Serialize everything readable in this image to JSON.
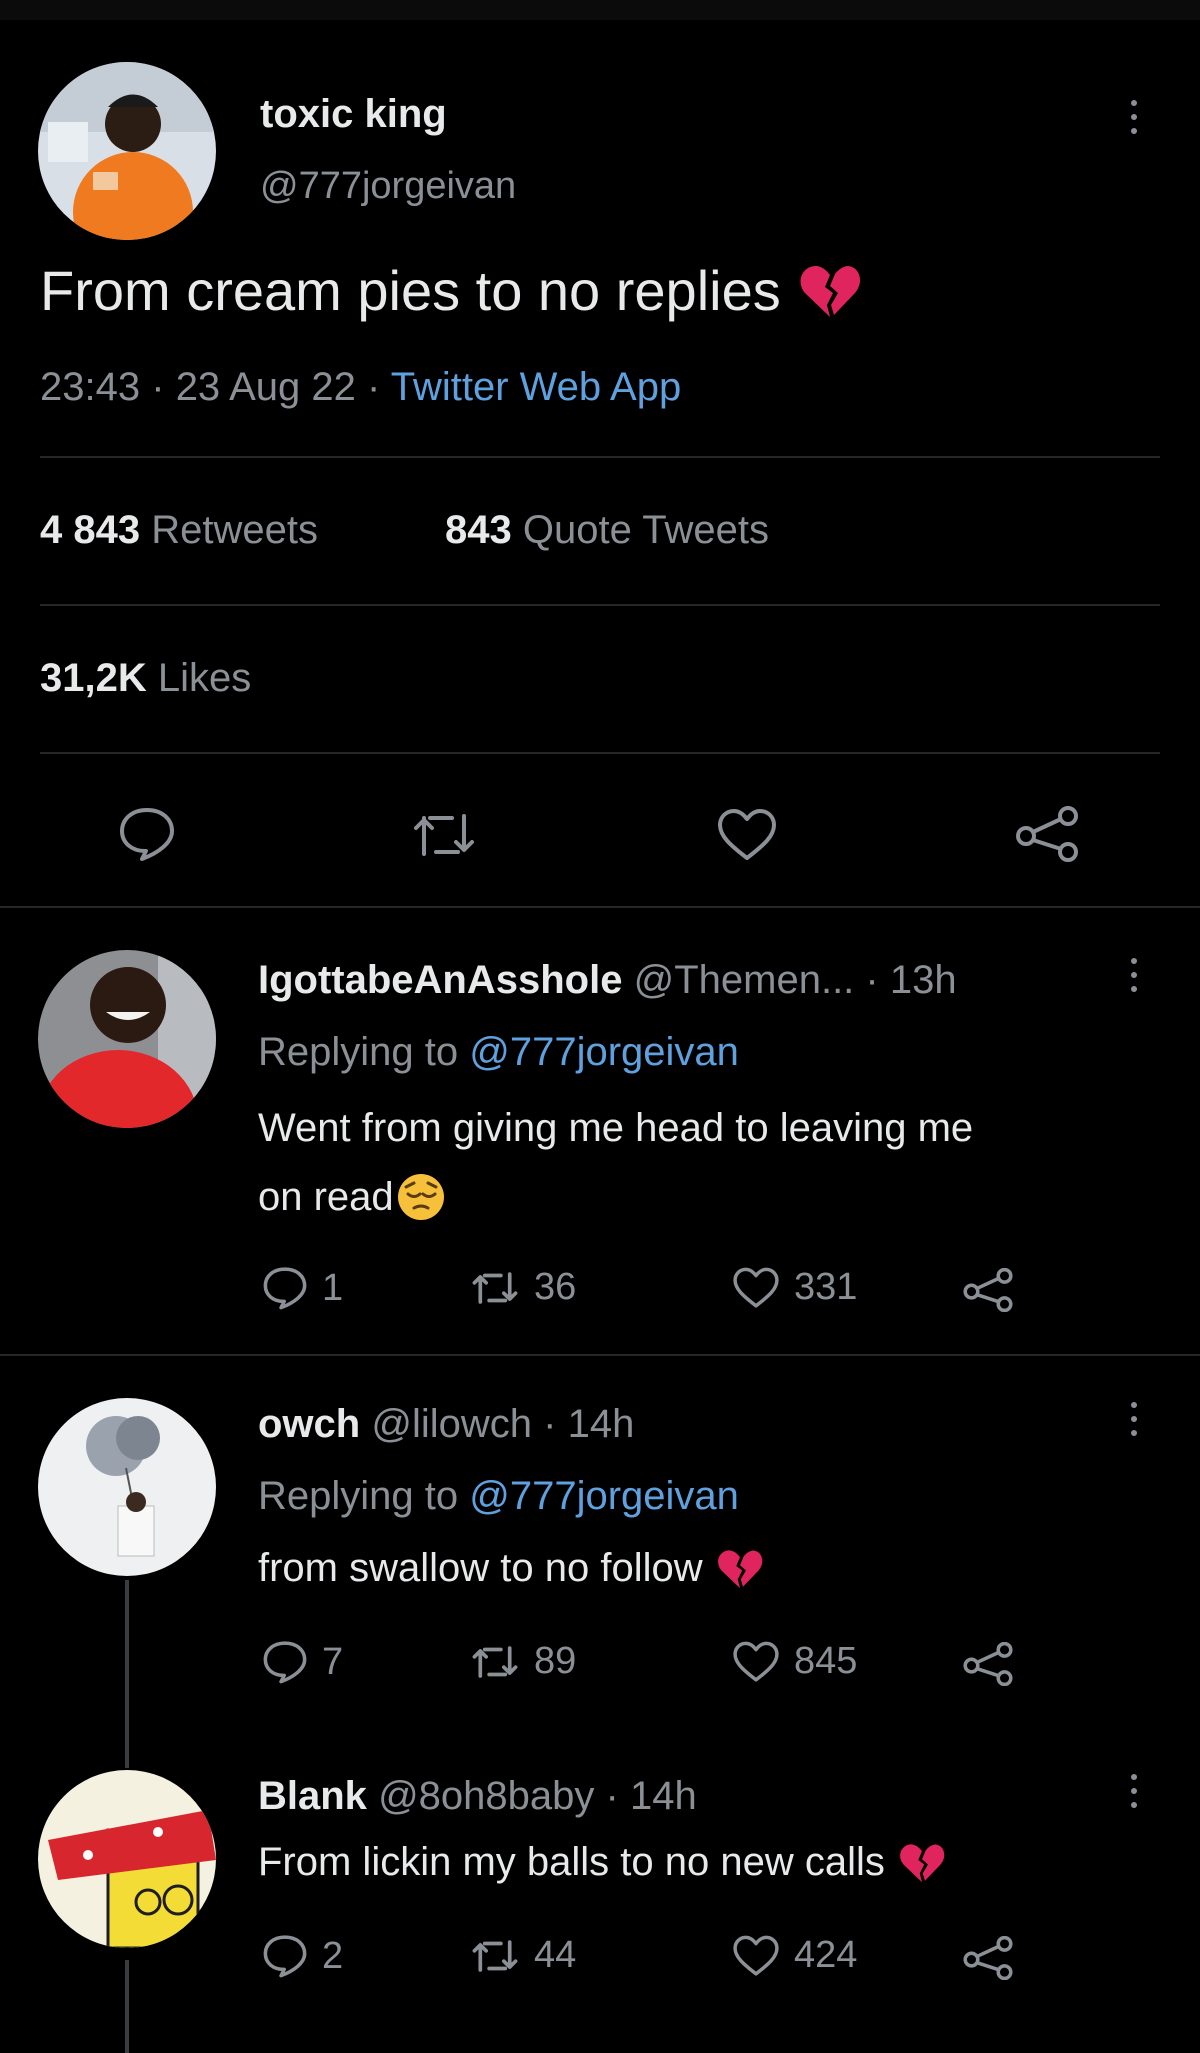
{
  "main_tweet": {
    "display_name": "toxic king",
    "handle": "@777jorgeivan",
    "text": "From cream pies to no replies",
    "emoji": "broken-heart",
    "time": "23:43",
    "date": "23 Aug 22",
    "sep": "·",
    "client": "Twitter Web App",
    "retweets_count": "4 843",
    "retweets_label": "Retweets",
    "quotes_count": "843",
    "quotes_label": "Quote Tweets",
    "likes_count": "31,2K",
    "likes_label": "Likes"
  },
  "replies": [
    {
      "display_name": "IgottabeAnAsshole",
      "handle": "@Themen...",
      "time": "· 13h",
      "replying_prefix": "Replying to",
      "replying_to": "@777jorgeivan",
      "text_line1": "Went from giving me head to leaving me",
      "text_line2": "on read",
      "emoji": "pensive-face",
      "reply_count": "1",
      "retweet_count": "36",
      "like_count": "331"
    },
    {
      "display_name": "owch",
      "handle": "@lilowch",
      "time": "· 14h",
      "replying_prefix": "Replying to",
      "replying_to": "@777jorgeivan",
      "text": "from swallow to no follow",
      "emoji": "broken-heart",
      "reply_count": "7",
      "retweet_count": "89",
      "like_count": "845"
    },
    {
      "display_name": "Blank",
      "handle": "@8oh8baby",
      "time": "· 14h",
      "text": "From lickin my balls to no new calls",
      "emoji": "broken-heart",
      "reply_count": "2",
      "retweet_count": "44",
      "like_count": "424"
    }
  ],
  "colors": {
    "background": "#000000",
    "text": "#e7e9ea",
    "secondary": "#8b9096",
    "link": "#5fa0de",
    "broken_heart": "#e0245e"
  }
}
